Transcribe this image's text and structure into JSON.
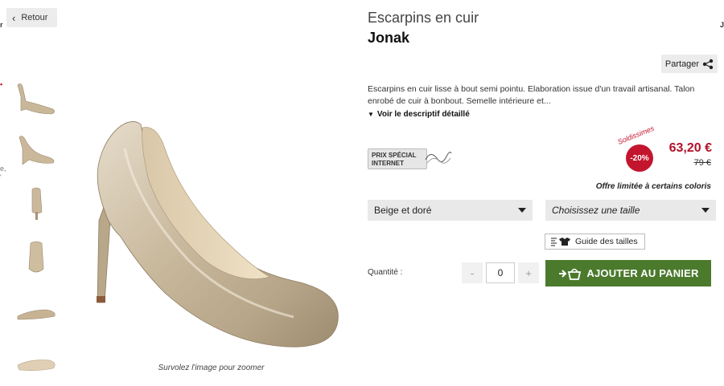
{
  "nav": {
    "back_label": "Retour"
  },
  "edge_fragments": {
    "left_top": "r",
    "right_top": "J",
    "left_dot": "•",
    "left_mid": "e,",
    "left_mid2": "'"
  },
  "gallery": {
    "thumbnails": [
      {
        "icon": "shoe-side-thumb-icon"
      },
      {
        "icon": "shoe-angle-thumb-icon"
      },
      {
        "icon": "shoe-back-thumb-icon"
      },
      {
        "icon": "shoe-front-thumb-icon"
      },
      {
        "icon": "shoe-profile-thumb-icon"
      },
      {
        "icon": "shoe-sole-thumb-icon"
      }
    ],
    "zoom_hint": "Survolez l'image pour zoomer"
  },
  "product": {
    "type": "Escarpins en cuir",
    "brand": "Jonak",
    "description": "Escarpins en cuir lisse à bout semi pointu. Elaboration issue d'un travail artisanal. Talon enrobé de cuir à bonbout. Semelle intérieure et...",
    "details_link": "Voir le descriptif détaillé"
  },
  "share": {
    "label": "Partager",
    "icon": "share-icon"
  },
  "promo": {
    "line1": "PRIX SPÉCIAL",
    "line2": "INTERNET"
  },
  "pricing": {
    "soldes_label": "Soldissimes",
    "discount": "-20%",
    "price": "63,20 €",
    "old_price": "79 €",
    "offer_note": "Offre limitée à certains coloris",
    "accent_color": "#c3152e"
  },
  "options": {
    "color_selected": "Beige et doré",
    "size_placeholder": "Choisissez une taille",
    "size_guide": "Guide des tailles"
  },
  "quantity": {
    "label": "Quantité :",
    "value": "0",
    "minus": "-",
    "plus": "+"
  },
  "cart": {
    "label": "AJOUTER AU PANIER",
    "icon": "basket-icon",
    "color": "#4b7a2d"
  }
}
